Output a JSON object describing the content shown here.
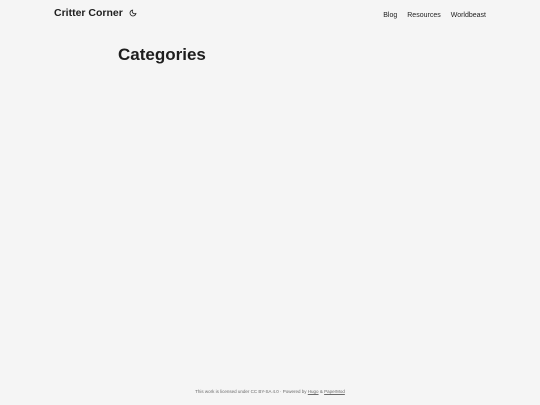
{
  "header": {
    "logo_text": "Critter Corner",
    "theme_toggle_icon": "moon-icon",
    "menu": [
      {
        "label": "Blog"
      },
      {
        "label": "Resources"
      },
      {
        "label": "Worldbeast"
      }
    ]
  },
  "main": {
    "title": "Categories"
  },
  "footer": {
    "license_text": "This work is licensed under CC BY-SA 4.0 · Powered by",
    "hugo_link": "Hugo",
    "separator": "&",
    "papermod_link": "PaperMod"
  },
  "colors": {
    "background": "#f5f5f5",
    "text": "#1e1e1e",
    "footer_text": "#6b6b6b"
  }
}
